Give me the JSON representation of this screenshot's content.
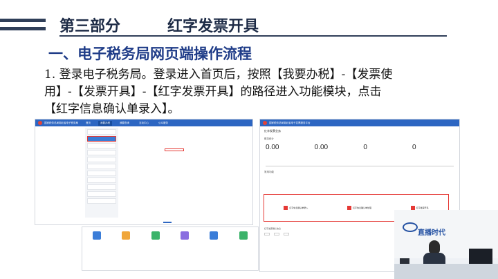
{
  "header": {
    "part_title": "第三部分",
    "topic_title": "红字发票开具"
  },
  "section": {
    "heading": "一、电子税务局网页端操作流程"
  },
  "step1": {
    "line1": "1. 登录电子税务局。登录进入首页后，按照【我要办税】-【发票使",
    "line2": "用】-【发票开具】-【红字发票开具】的路径进入功能模块，点击",
    "line3": "【红字信息确认单录入】。"
  },
  "screenshots": {
    "portal_header": "国家税务总局湖北省电子税务局",
    "nav_tabs": [
      "首页",
      "我要办税",
      "我要查询",
      "互动中心",
      "公众服务"
    ],
    "right_panel_header": "国家税务总局湖北省电子发票服务平台",
    "red_invoice_title": "红字发票业务",
    "overview_label": "概览统计",
    "metrics": [
      {
        "caption": "",
        "value": "0.00"
      },
      {
        "caption": "",
        "value": "0.00"
      },
      {
        "caption": "",
        "value": "0"
      },
      {
        "caption": "",
        "value": "0"
      }
    ],
    "common_functions": "常用功能",
    "cards": [
      "红字信息确认单录入",
      "红字信息确认单处理",
      "红字发票开具"
    ],
    "pending_list": "红字发票确认信息"
  },
  "video_overlay": {
    "brand": "直播时代"
  },
  "colors": {
    "navy": "#1d2b46",
    "section_blue": "#1f3c88",
    "highlight_red": "#e53935",
    "portal_blue": "#2d66c2"
  }
}
